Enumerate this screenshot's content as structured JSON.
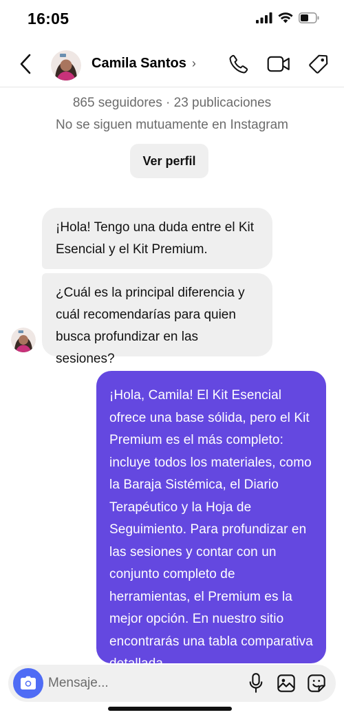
{
  "status": {
    "time": "16:05"
  },
  "header": {
    "name": "Camila Santos",
    "chevron": "›"
  },
  "profile": {
    "stats": "865 seguidores · 23 publicaciones",
    "mutual": "No se siguen mutuamente en Instagram",
    "view_profile_label": "Ver perfil"
  },
  "messages": [
    {
      "from": "contact",
      "text": "¡Hola! Tengo una duda entre el Kit Esencial y el Kit Premium."
    },
    {
      "from": "contact",
      "text": "¿Cuál es la principal diferencia y cuál recomendarías para quien busca profundizar en las sesiones?"
    },
    {
      "from": "me",
      "text": "¡Hola, Camila! El Kit Esencial ofrece una base sólida, pero el Kit Premium es el más completo: incluye todos los materiales, como la Baraja Sistémica, el Diario Terapéutico y la Hoja de Seguimiento. Para profundizar en las sesiones y contar con un conjunto completo de herramientas, el Premium es la mejor opción. En nuestro sitio encontrarás una tabla comparativa detallada."
    }
  ],
  "composer": {
    "placeholder": "Mensaje..."
  },
  "icons": {
    "back": "chevron-left-icon",
    "phone": "phone-icon",
    "video": "video-camera-icon",
    "tag": "tag-icon",
    "camera": "camera-icon",
    "mic": "microphone-icon",
    "gallery": "image-icon",
    "sticker": "sticker-icon"
  },
  "colors": {
    "outgoing_bubble": "#6448e0",
    "incoming_bubble": "#efefef",
    "camera_button": "#4f6cf5"
  }
}
